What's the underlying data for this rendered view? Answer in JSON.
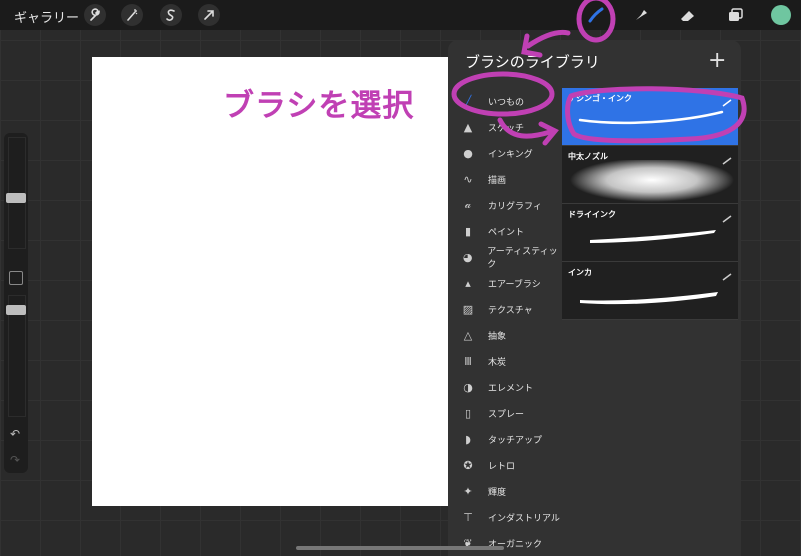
{
  "topbar": {
    "gallery_label": "ギャラリー",
    "left_tools": [
      "wrench-icon",
      "magic-wand-icon",
      "selection-s-icon",
      "arrow-icon"
    ],
    "right_tools": [
      "brush-icon",
      "smudge-icon",
      "eraser-icon",
      "layers-icon"
    ],
    "accent_color": "#2f73e6",
    "current_color": "#6fc6a0"
  },
  "panel": {
    "title": "ブラシのライブラリ",
    "add_label": "+",
    "categories": [
      {
        "label": "いつもの",
        "icon": "brush-stroke-icon",
        "selected": true
      },
      {
        "label": "スケッチ",
        "icon": "pencil-tip-icon"
      },
      {
        "label": "インキング",
        "icon": "ink-drop-icon"
      },
      {
        "label": "描画",
        "icon": "squiggle-icon"
      },
      {
        "label": "カリグラフィ",
        "icon": "calligraphy-a-icon"
      },
      {
        "label": "ペイント",
        "icon": "paintbrush-icon"
      },
      {
        "label": "アーティスティック",
        "icon": "palette-icon"
      },
      {
        "label": "エアーブラシ",
        "icon": "airbrush-icon"
      },
      {
        "label": "テクスチャ",
        "icon": "texture-icon"
      },
      {
        "label": "抽象",
        "icon": "triangle-icon"
      },
      {
        "label": "木炭",
        "icon": "charcoal-icon"
      },
      {
        "label": "エレメント",
        "icon": "yin-yang-icon"
      },
      {
        "label": "スプレー",
        "icon": "spray-can-icon"
      },
      {
        "label": "タッチアップ",
        "icon": "touchup-icon"
      },
      {
        "label": "レトロ",
        "icon": "retro-star-icon"
      },
      {
        "label": "輝度",
        "icon": "sparkle-icon"
      },
      {
        "label": "インダストリアル",
        "icon": "anvil-icon"
      },
      {
        "label": "オーガニック",
        "icon": "leaf-icon"
      }
    ],
    "brushes": [
      {
        "name": "ゲシンゴ・インク",
        "selected": true
      },
      {
        "name": "中太ノズル",
        "selected": false
      },
      {
        "name": "ドライインク",
        "selected": false
      },
      {
        "name": "インカ",
        "selected": false
      }
    ]
  },
  "annotation": {
    "text": "ブラシを選択",
    "color": "#c040b4"
  }
}
